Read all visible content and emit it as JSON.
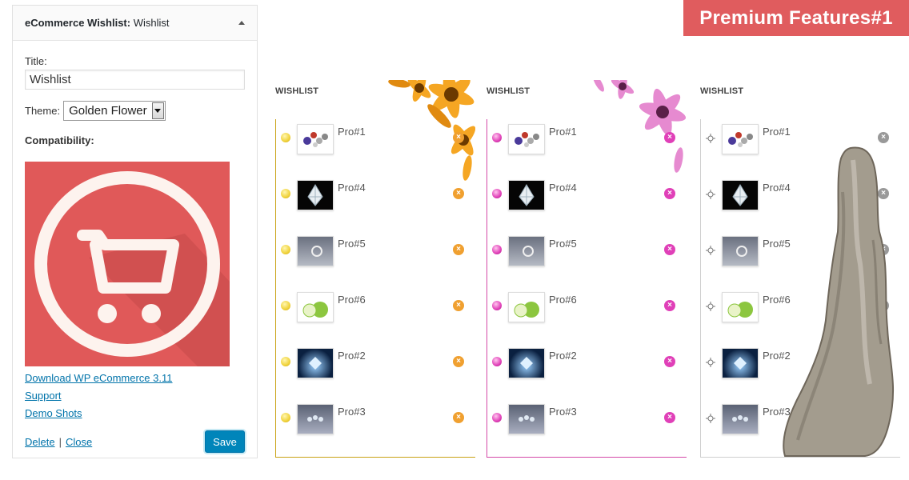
{
  "widget": {
    "header_strong": "eCommerce Wishlist:",
    "header_rest": " Wishlist",
    "title_label": "Title:",
    "title_value": "Wishlist",
    "theme_label": "Theme:",
    "theme_value": "Golden Flower",
    "compat_label": "Compatibility:",
    "links": [
      "Download WP eCommerce 3.11",
      "Support",
      "Demo Shots"
    ],
    "delete_label": "Delete",
    "separator": "|",
    "close_label": "Close",
    "save_label": "Save"
  },
  "premium": {
    "label": "Premium Features#1"
  },
  "columns": [
    {
      "title": "WISHLIST",
      "theme": "gold"
    },
    {
      "title": "WISHLIST",
      "theme": "pink"
    },
    {
      "title": "WISHLIST",
      "theme": "gray"
    }
  ],
  "products": [
    "Pro#1",
    "Pro#4",
    "Pro#5",
    "Pro#6",
    "Pro#2",
    "Pro#3"
  ],
  "remove_glyph": "×",
  "colors": {
    "accent_red": "#e05c5e",
    "gold": "#f0a030",
    "pink": "#e040b8",
    "link": "#0073aa",
    "button": "#0085ba"
  }
}
